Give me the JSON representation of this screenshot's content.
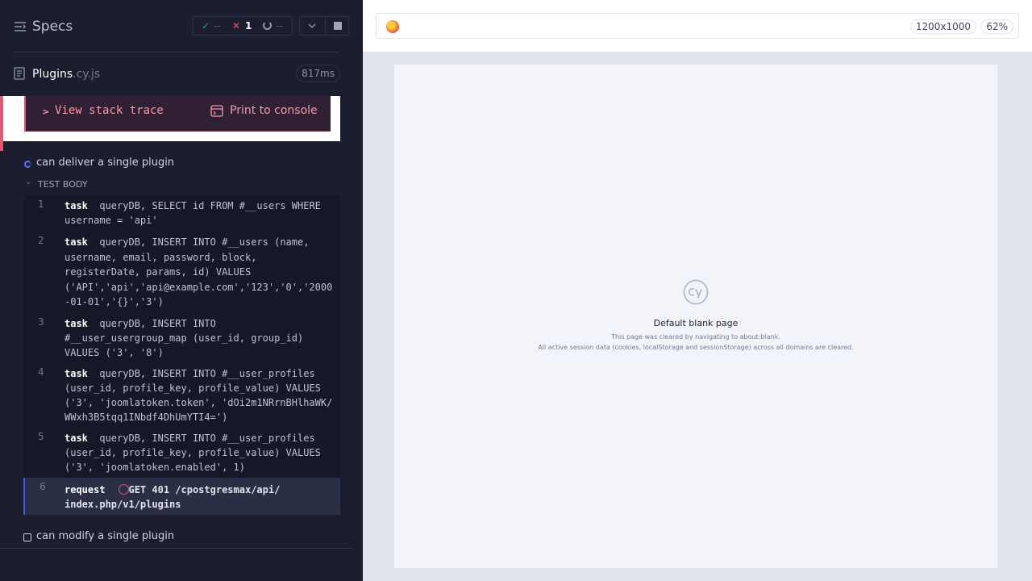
{
  "header": {
    "title": "Specs",
    "stats": {
      "passed": "--",
      "failed": "1",
      "pending": "--"
    }
  },
  "spec": {
    "name": "Plugins",
    "extension": ".cy.js",
    "duration": "817ms"
  },
  "error": {
    "stack_trace_label": "View stack trace",
    "print_label": "Print to console"
  },
  "test": {
    "title": "can deliver a single plugin",
    "section_label": "TEST BODY",
    "commands": [
      {
        "number": "1",
        "name": "task",
        "message": "queryDB, SELECT id FROM #__users WHERE\nusername = 'api'"
      },
      {
        "number": "2",
        "name": "task",
        "message": "queryDB, INSERT INTO #__users (name,\nusername, email, password, block,\nregisterDate, params, id) VALUES\n('API','api','api@example.com','123','0','2000\n-01-01','{}','3')"
      },
      {
        "number": "3",
        "name": "task",
        "message": "queryDB, INSERT INTO\n#__user_usergroup_map (user_id, group_id)\nVALUES ('3', '8')"
      },
      {
        "number": "4",
        "name": "task",
        "message": "queryDB, INSERT INTO #__user_profiles\n(user_id, profile_key, profile_value) VALUES\n('3', 'joomlatoken.token', 'dOi2m1NRrnBHlhaWK/\nWWxh3B5tqq1INbdf4DhUmYTI4=')"
      },
      {
        "number": "5",
        "name": "task",
        "message": "queryDB, INSERT INTO #__user_profiles\n(user_id, profile_key, profile_value) VALUES\n('3', 'joomlatoken.enabled', 1)"
      },
      {
        "number": "6",
        "name": "request",
        "message": "GET 401 /cpostgresmax/api/\nindex.php/v1/plugins"
      }
    ]
  },
  "next_test": {
    "title": "can modify a single plugin"
  },
  "aut": {
    "viewport": "1200x1000",
    "zoom": "62%",
    "blank_title": "Default blank page",
    "blank_line1": "This page was cleared by navigating to about:blank.",
    "blank_line2": "All active session data (cookies, localStorage and sessionStorage) across all domains are cleared."
  },
  "colors": {
    "accent": "#4956e3",
    "fail": "#e45770",
    "pass": "#1fa971"
  }
}
